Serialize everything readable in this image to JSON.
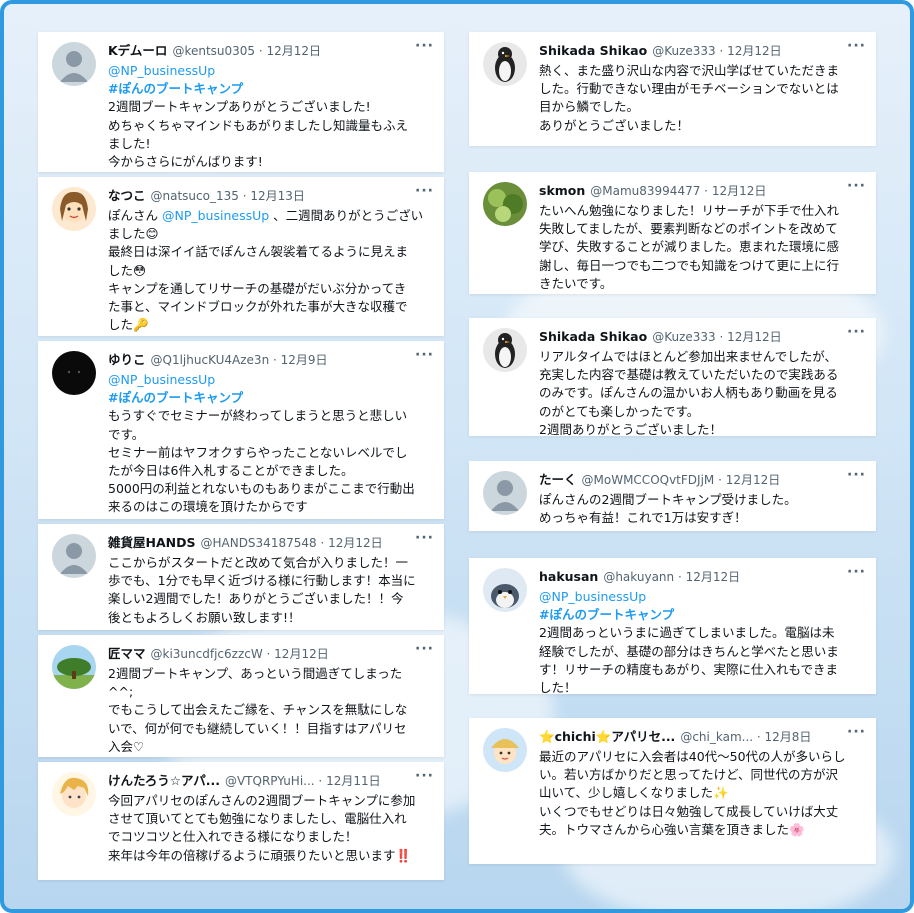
{
  "left": [
    {
      "name": "Kデムーロ",
      "handle": "@kentsu0305",
      "date": "12月12日",
      "avatar": "default-avatar",
      "lines": [
        {
          "cls": "blue",
          "t": "@NP_businessUp"
        },
        {
          "cls": "tag",
          "t": "#ぽんのブートキャンプ"
        },
        {
          "t": "2週間ブートキャンプありがとうございました!"
        },
        {
          "t": "めちゃくちゃマインドもあがりましたし知識量もふえ"
        },
        {
          "t": "ました!"
        },
        {
          "t": "今からさらにがんばります!"
        }
      ]
    },
    {
      "name": "なつこ",
      "handle": "@natsuco_135",
      "date": "12月13日",
      "avatar": "natsuko-avatar",
      "lines": [
        {
          "t": "ぽんさん ",
          "mention": "@NP_businessUp",
          "after": " 、二週間ありがとうござい"
        },
        {
          "t": "ました😊"
        },
        {
          "t": "最終日は深イイ話でぽんさん袈裟着てるように見えま"
        },
        {
          "t": "した😳"
        },
        {
          "t": "キャンプを通してリサーチの基礎がだいぶ分かってき"
        },
        {
          "t": "た事と、マインドブロックが外れた事が大きな収穫で"
        },
        {
          "t": "した🔑"
        }
      ]
    },
    {
      "name": "ゆりこ",
      "handle": "@Q1ljhucKU4Aze3n",
      "date": "12月9日",
      "avatar": "black-avatar",
      "lines": [
        {
          "cls": "blue",
          "t": "@NP_businessUp"
        },
        {
          "cls": "tag",
          "t": "#ぽんのブートキャンプ"
        },
        {
          "t": "もうすぐでセミナーが終わってしまうと思うと悲しい"
        },
        {
          "t": "です。"
        },
        {
          "t": "セミナー前はヤフオクすらやったことないレベルでし"
        },
        {
          "t": "たが今日は6件入札することができました。"
        },
        {
          "t": "5000円の利益とれないものもありまがここまで行動出"
        },
        {
          "t": "来るのはこの環境を頂けたからです"
        }
      ]
    },
    {
      "name": "雑貨屋HANDS",
      "handle": "@HANDS34187548",
      "date": "12月12日",
      "avatar": "default-avatar",
      "lines": [
        {
          "t": "ここからがスタートだと改めて気合が入りました！一"
        },
        {
          "t": "歩でも、1分でも早く近づける様に行動します！本当に"
        },
        {
          "t": "楽しい2週間でした！ありがとうございました！！今"
        },
        {
          "t": "後ともよろしくお願い致します!！"
        }
      ]
    },
    {
      "name": "匠ママ",
      "handle": "@ki3uncdfjc6zzcW",
      "date": "12月12日",
      "avatar": "tree-avatar",
      "lines": [
        {
          "t": "2週間ブートキャンプ、あっという間過ぎてしまった"
        },
        {
          "t": "^^;"
        },
        {
          "t": "でもこうして出会えたご縁を、チャンスを無駄にしな"
        },
        {
          "t": "いで、何が何でも継続していく！！目指すはアパリセ"
        },
        {
          "t": "入会♡"
        }
      ]
    },
    {
      "name": "けんたろう☆アパ...",
      "handle": "@VTQRPYuHi...",
      "date": "12月11日",
      "avatar": "anime-avatar",
      "lines": [
        {
          "t": "今回アパリセのぽんさんの2週間ブートキャンプに参加"
        },
        {
          "t": "させて頂いてとても勉強になりましたし、電脳仕入れ"
        },
        {
          "t": "でコツコツと仕入れできる様になりました！"
        },
        {
          "t": "来年は今年の倍稼げるように頑張りたいと思います‼️"
        }
      ]
    }
  ],
  "right": [
    {
      "name": "Shikada Shikao",
      "handle": "@Kuze333",
      "date": "12月12日",
      "avatar": "penguin-avatar",
      "lines": [
        {
          "t": "熱く、また盛り沢山な内容で沢山学ばせていただきま"
        },
        {
          "t": "した。行動できない理由がモチベーションでないとは"
        },
        {
          "t": "目から鱗でした。"
        },
        {
          "t": "ありがとうございました！"
        }
      ]
    },
    {
      "name": "skmon",
      "handle": "@Mamu83994477",
      "date": "12月12日",
      "avatar": "plant-avatar",
      "lines": [
        {
          "t": "たいへん勉強になりました！リサーチが下手で仕入れ"
        },
        {
          "t": "失敗してましたが、要素判断などのポイントを改めて"
        },
        {
          "t": "学び、失敗することが減りました。恵まれた環境に感"
        },
        {
          "t": "謝し、毎日一つでも二つでも知識をつけて更に上に行"
        },
        {
          "t": "きたいです。"
        }
      ]
    },
    {
      "name": "Shikada Shikao",
      "handle": "@Kuze333",
      "date": "12月12日",
      "avatar": "penguin-avatar",
      "lines": [
        {
          "t": "リアルタイムではほとんど参加出来ませんでしたが、"
        },
        {
          "t": "充実した内容で基礎は教えていただいたので実践ある"
        },
        {
          "t": "のみです。ぽんさんの温かいお人柄もあり動画を見る"
        },
        {
          "t": "のがとても楽しかったです。"
        },
        {
          "t": "2週間ありがとうございました！"
        }
      ]
    },
    {
      "name": "たーく",
      "handle": "@MoWMCCOQvtFDJjM",
      "date": "12月12日",
      "avatar": "default-avatar",
      "lines": [
        {
          "t": "ぽんさんの2週間ブートキャンプ受けました。"
        },
        {
          "t": "めっちゃ有益！これで1万は安すぎ！"
        }
      ]
    },
    {
      "name": "hakusan",
      "handle": "@hakuyann",
      "date": "12月12日",
      "avatar": "bird-avatar",
      "lines": [
        {
          "cls": "blue",
          "t": "@NP_businessUp"
        },
        {
          "cls": "tag",
          "t": "#ぽんのブートキャンプ"
        },
        {
          "t": "2週間あっというまに過ぎてしまいました。電脳は未"
        },
        {
          "t": "経験でしたが、基礎の部分はきちんと学べたと思いま"
        },
        {
          "t": "す！リサーチの精度もあがり、実際に仕入れもできま"
        },
        {
          "t": "した！"
        }
      ]
    },
    {
      "name": "⭐chichi⭐アパリセ...",
      "handle": "@chi_kam...",
      "date": "12月8日",
      "avatar": "cartoon-avatar",
      "lines": [
        {
          "t": "最近のアパリセに入会者は40代〜50代の人が多いらし"
        },
        {
          "t": "い。若い方ばかりだと思ってたけど、同世代の方が沢"
        },
        {
          "t": "山いて、少し嬉しくなりました✨"
        },
        {
          "t": " "
        },
        {
          "t": "いくつでもせどりは日々勉強して成長していけば大丈"
        },
        {
          "t": "夫。トウマさんから心強い言葉を頂きました🌸"
        }
      ]
    }
  ]
}
